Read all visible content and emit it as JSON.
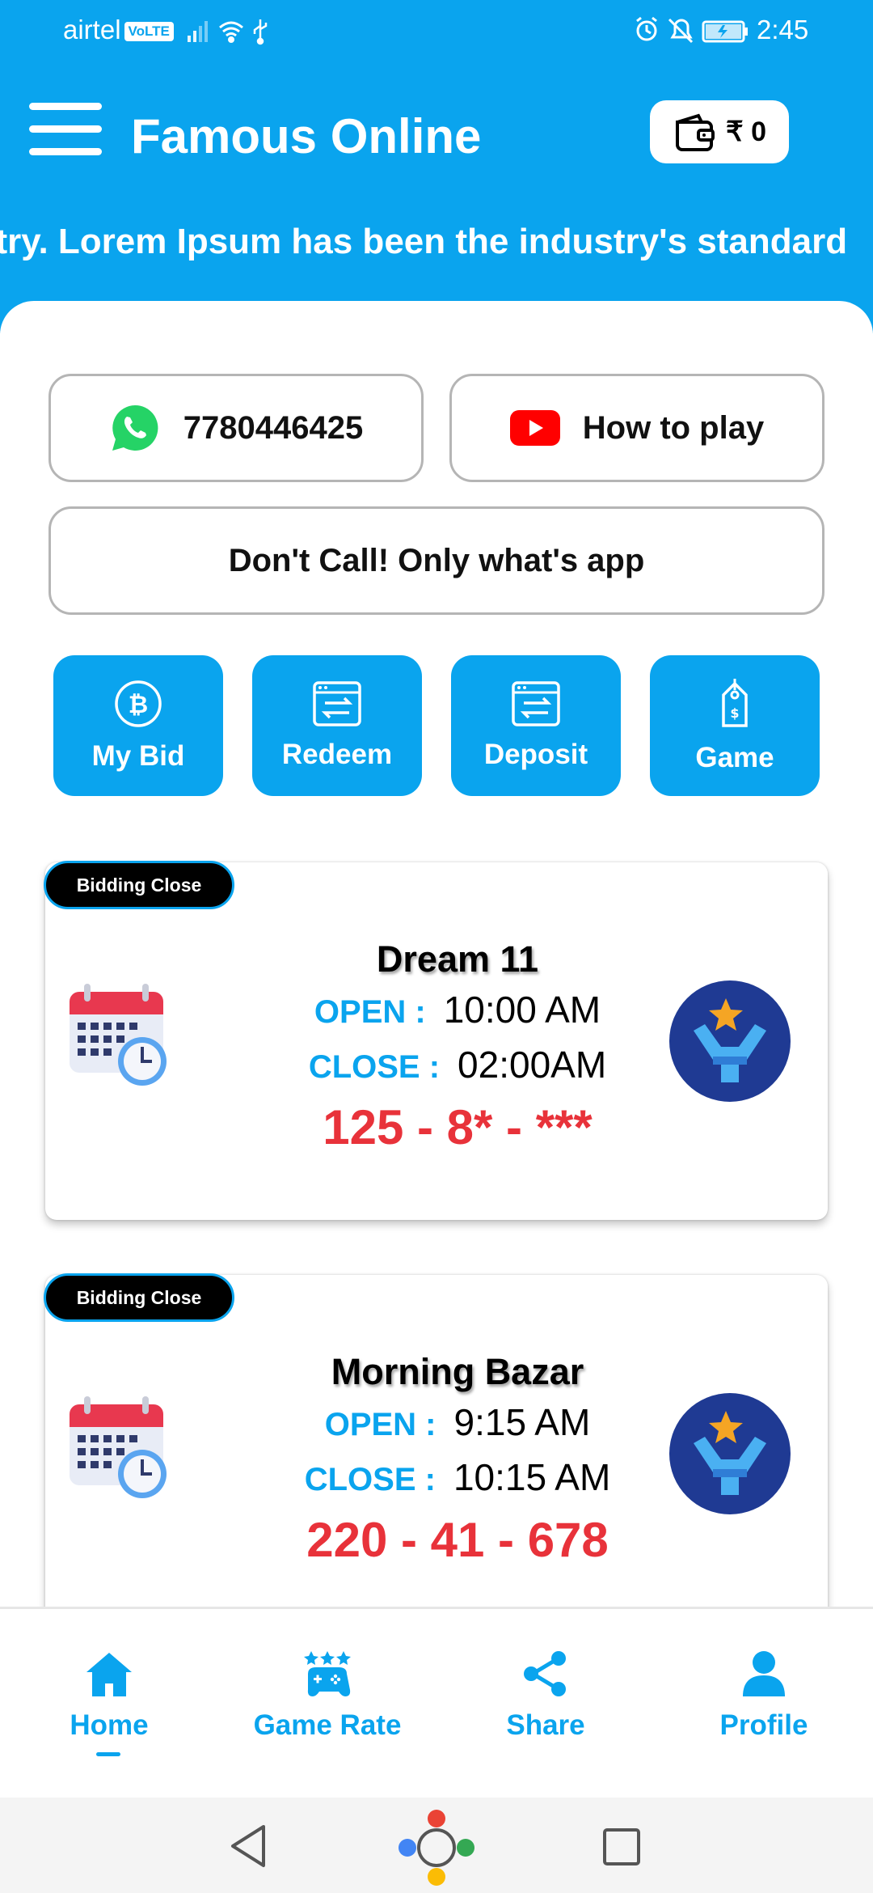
{
  "status_bar": {
    "carrier": "airtel",
    "volte": "VoLTE",
    "time": "2:45",
    "icons": [
      "signal-icon",
      "wifi-icon",
      "usb-icon",
      "alarm-icon",
      "mute-icon",
      "battery-icon"
    ]
  },
  "header": {
    "title": "Famous Online",
    "wallet_amount": "₹ 0",
    "marquee_text": "stry. Lorem Ipsum has been the industry's standard"
  },
  "contact": {
    "whatsapp_number": "7780446425",
    "how_to_play": "How to play",
    "notice": "Don't Call! Only what's app"
  },
  "quick_actions": [
    {
      "label": "My Bid",
      "icon": "bitcoin-icon"
    },
    {
      "label": "Redeem",
      "icon": "transfer-icon"
    },
    {
      "label": "Deposit",
      "icon": "transfer-icon"
    },
    {
      "label": "Game",
      "icon": "price-tag-icon"
    }
  ],
  "games": [
    {
      "badge": "Bidding Close",
      "name": "Dream 11",
      "open_label": "OPEN :",
      "open_time": "10:00 AM",
      "close_label": "CLOSE :",
      "close_time": "02:00AM",
      "result": "125 - 8* - ***"
    },
    {
      "badge": "Bidding Close",
      "name": "Morning Bazar",
      "open_label": "OPEN :",
      "open_time": "9:15 AM",
      "close_label": "CLOSE :",
      "close_time": "10:15 AM",
      "result": "220 - 41 - 678"
    }
  ],
  "bottom_nav": [
    {
      "label": "Home",
      "icon": "home-icon",
      "active": true
    },
    {
      "label": "Game Rate",
      "icon": "game-rate-icon",
      "active": false
    },
    {
      "label": "Share",
      "icon": "share-icon",
      "active": false
    },
    {
      "label": "Profile",
      "icon": "profile-icon",
      "active": false
    }
  ],
  "colors": {
    "primary": "#0aa4ee",
    "result_red": "#e8323a",
    "badge_black": "#000000",
    "whatsapp_green": "#25d366",
    "youtube_red": "#ff0000",
    "trophy_navy": "#1f3a93"
  }
}
